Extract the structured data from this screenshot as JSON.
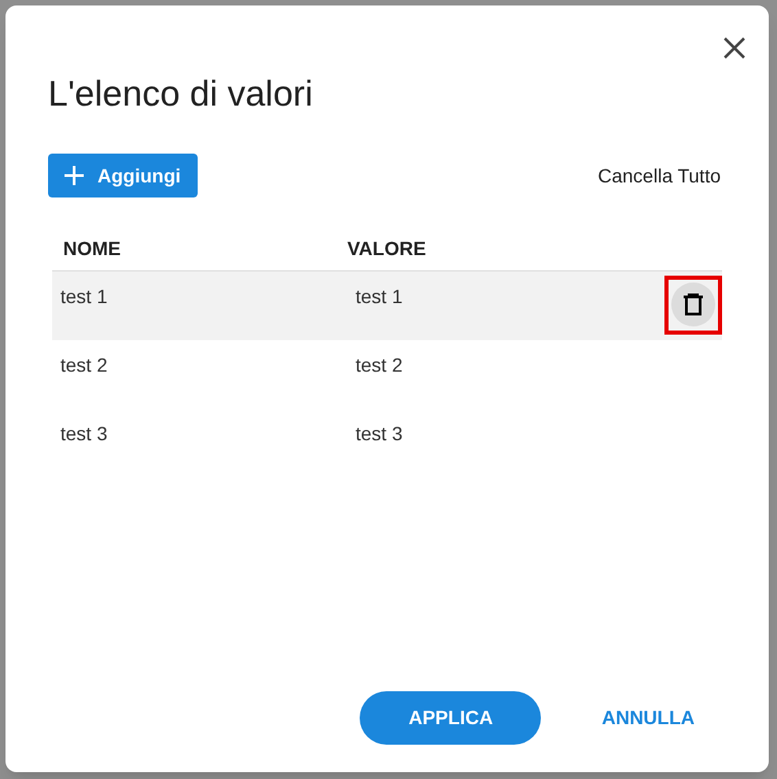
{
  "dialog": {
    "title": "L'elenco di valori",
    "add_button": "Aggiungi",
    "clear_button": "Cancella Tutto",
    "columns": [
      "NOME",
      "VALORE"
    ],
    "rows": [
      {
        "name": "test 1",
        "value": "test 1",
        "selected": true
      },
      {
        "name": "test 2",
        "value": "test 2",
        "selected": false
      },
      {
        "name": "test 3",
        "value": "test 3",
        "selected": false
      }
    ],
    "apply_button": "APPLICA",
    "cancel_button": "ANNULLA"
  }
}
